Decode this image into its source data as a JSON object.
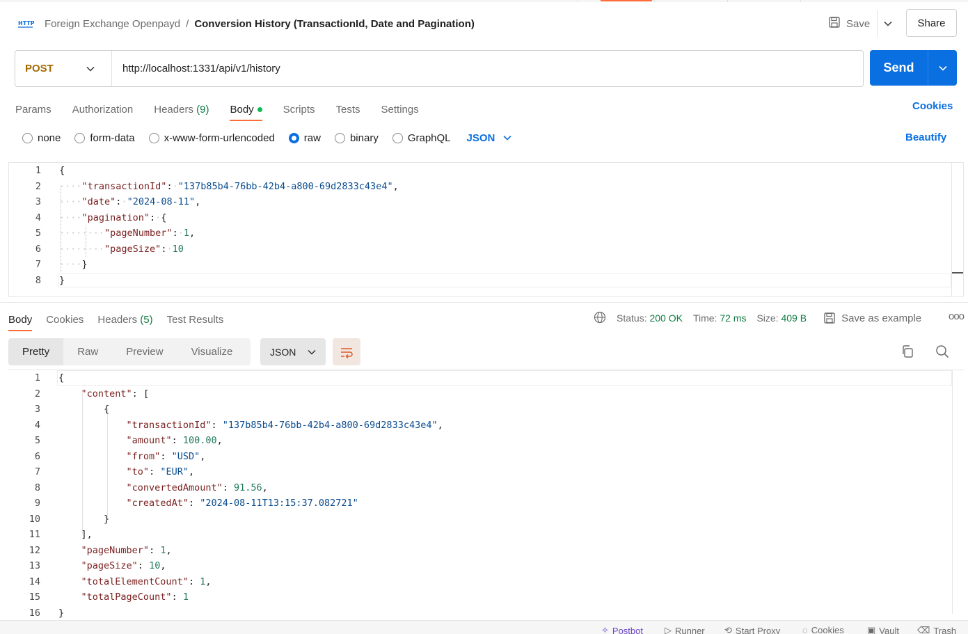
{
  "header": {
    "collection": "Foreign Exchange Openpayd",
    "separator": "/",
    "request_name": "Conversion History (TransactionId, Date and Pagination)",
    "save_label": "Save",
    "share_label": "Share",
    "http_icon": "http-icon"
  },
  "request": {
    "method": "POST",
    "url": "http://localhost:1331/api/v1/history",
    "send_label": "Send"
  },
  "request_tabs": {
    "params": "Params",
    "authorization": "Authorization",
    "headers": "Headers",
    "headers_count": "(9)",
    "body": "Body",
    "scripts": "Scripts",
    "tests": "Tests",
    "settings": "Settings",
    "active": "Body",
    "cookies": "Cookies"
  },
  "body_types": {
    "none": "none",
    "form_data": "form-data",
    "urlencoded": "x-www-form-urlencoded",
    "raw": "raw",
    "binary": "binary",
    "graphql": "GraphQL",
    "selected": "raw",
    "format": "JSON",
    "beautify": "Beautify"
  },
  "request_body": {
    "line_numbers": [
      "1",
      "2",
      "3",
      "4",
      "5",
      "6",
      "7",
      "8"
    ],
    "brace_open": "{",
    "brace_close": "}",
    "k_transactionId": "\"transactionId\"",
    "v_transactionId": "\"137b85b4-76bb-42b4-a800-69d2833c43e4\"",
    "k_date": "\"date\"",
    "v_date": "\"2024-08-11\"",
    "k_pagination": "\"pagination\"",
    "k_pageNumber": "\"pageNumber\"",
    "v_pageNumber": "1",
    "k_pageSize": "\"pageSize\"",
    "v_pageSize": "10"
  },
  "response_tabs": {
    "body": "Body",
    "cookies": "Cookies",
    "headers": "Headers",
    "headers_count": "(5)",
    "test_results": "Test Results",
    "active": "Body"
  },
  "response_status": {
    "status_label": "Status:",
    "status_value": "200 OK",
    "time_label": "Time:",
    "time_value": "72 ms",
    "size_label": "Size:",
    "size_value": "409 B",
    "save_example": "Save as example",
    "more": "ooo"
  },
  "response_view": {
    "pretty": "Pretty",
    "raw": "Raw",
    "preview": "Preview",
    "visualize": "Visualize",
    "format": "JSON",
    "active": "Pretty"
  },
  "response_body": {
    "line_numbers": [
      "1",
      "2",
      "3",
      "4",
      "5",
      "6",
      "7",
      "8",
      "9",
      "10",
      "11",
      "12",
      "13",
      "14",
      "15",
      "16"
    ],
    "brace_open": "{",
    "k_content": "\"content\"",
    "bracket_open": "[",
    "obj_open": "{",
    "k_transactionId": "\"transactionId\"",
    "v_transactionId": "\"137b85b4-76bb-42b4-a800-69d2833c43e4\"",
    "k_amount": "\"amount\"",
    "v_amount": "100.00",
    "k_from": "\"from\"",
    "v_from": "\"USD\"",
    "k_to": "\"to\"",
    "v_to": "\"EUR\"",
    "k_convertedAmount": "\"convertedAmount\"",
    "v_convertedAmount": "91.56",
    "k_createdAt": "\"createdAt\"",
    "v_createdAt": "\"2024-08-11T13:15:37.082721\"",
    "obj_close": "}",
    "bracket_close": "],",
    "k_pageNumber": "\"pageNumber\"",
    "v_pageNumber": "1",
    "k_pageSize": "\"pageSize\"",
    "v_pageSize": "10",
    "k_totalElementCount": "\"totalElementCount\"",
    "v_totalElementCount": "1",
    "k_totalPageCount": "\"totalPageCount\"",
    "v_totalPageCount": "1",
    "brace_close": "}"
  },
  "footer": {
    "postbot": "Postbot",
    "runner": "Runner",
    "start_proxy": "Start Proxy",
    "cookies": "Cookies",
    "vault": "Vault",
    "trash": "Trash"
  },
  "colors": {
    "accent": "#ff6c37",
    "primary": "#0a6fe0",
    "method_post": "#a36a00",
    "status_ok": "#107c41"
  }
}
